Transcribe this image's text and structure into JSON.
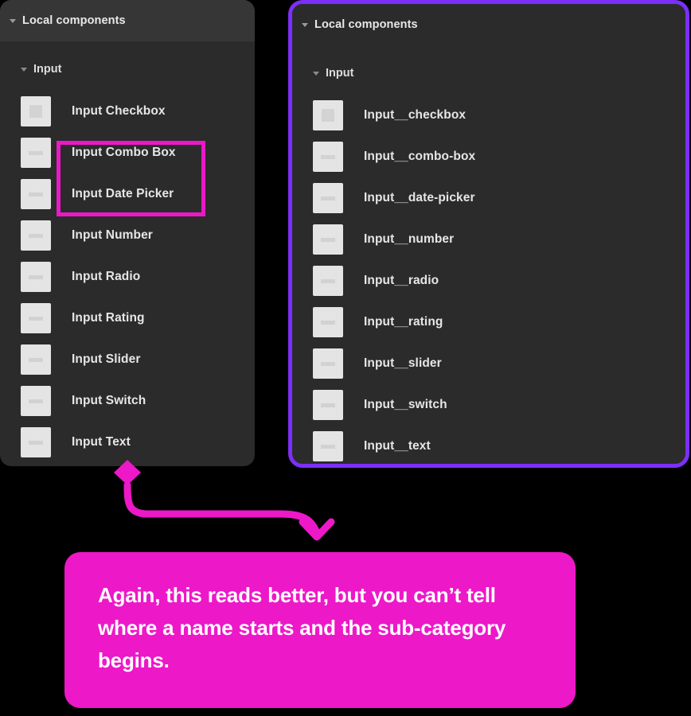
{
  "panels": {
    "left": {
      "header_title": "Local components",
      "group_label": "Input",
      "items": [
        {
          "label": "Input Checkbox",
          "icon": "component-checkbox-icon"
        },
        {
          "label": "Input Combo Box",
          "icon": "component-icon"
        },
        {
          "label": "Input Date Picker",
          "icon": "component-icon"
        },
        {
          "label": "Input Number",
          "icon": "component-icon"
        },
        {
          "label": "Input Radio",
          "icon": "component-icon"
        },
        {
          "label": "Input Rating",
          "icon": "component-icon"
        },
        {
          "label": "Input Slider",
          "icon": "component-icon"
        },
        {
          "label": "Input Switch",
          "icon": "component-icon"
        },
        {
          "label": "Input Text",
          "icon": "component-icon"
        }
      ]
    },
    "right": {
      "header_title": "Local components",
      "group_label": "Input",
      "items": [
        {
          "label": "Input__checkbox",
          "icon": "component-checkbox-icon"
        },
        {
          "label": "Input__combo-box",
          "icon": "component-icon"
        },
        {
          "label": "Input__date-picker",
          "icon": "component-icon"
        },
        {
          "label": "Input__number",
          "icon": "component-icon"
        },
        {
          "label": "Input__radio",
          "icon": "component-icon"
        },
        {
          "label": "Input__rating",
          "icon": "component-icon"
        },
        {
          "label": "Input__slider",
          "icon": "component-icon"
        },
        {
          "label": "Input__switch",
          "icon": "component-icon"
        },
        {
          "label": "Input__text",
          "icon": "component-icon"
        }
      ]
    }
  },
  "annotation": {
    "callout_text": "Again, this reads better, but you can’t tell where a name starts and the sub-category begins.",
    "highlight_color": "#ec18c8",
    "callout_color": "#ed18c8",
    "panel_outline_color": "#7b2ff7",
    "connector_color": "#ed18c8"
  },
  "colors": {
    "background": "#000000",
    "panel_background": "#2b2b2b",
    "panel_header_background": "#363636",
    "text_primary": "#e6e6e6",
    "icon_fill": "#e4e4e4"
  }
}
